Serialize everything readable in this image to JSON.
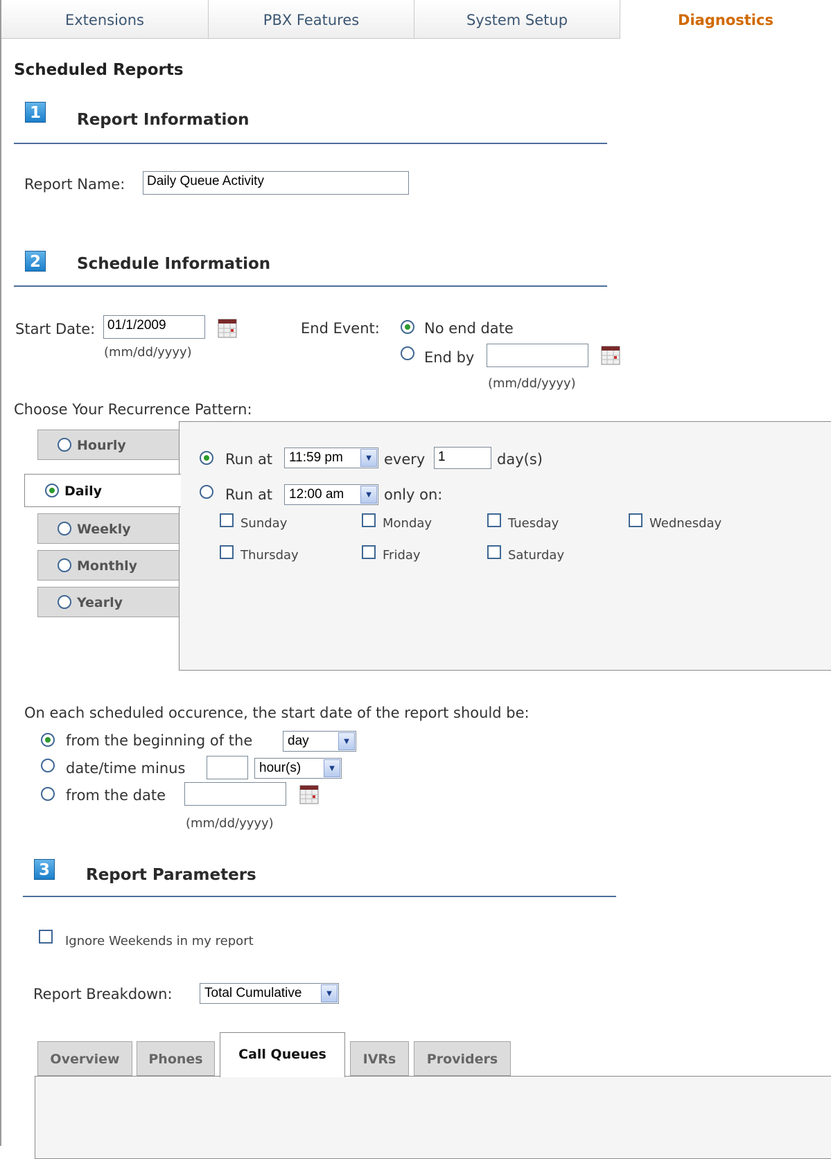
{
  "nav": {
    "tabs": [
      "Extensions",
      "PBX Features",
      "System Setup",
      "Diagnostics"
    ],
    "active": "Diagnostics"
  },
  "page_title": "Scheduled Reports",
  "section1": {
    "number": "1",
    "title": "Report Information",
    "report_name_label": "Report Name:",
    "report_name_value": "Daily Queue Activity"
  },
  "section2": {
    "number": "2",
    "title": "Schedule Information",
    "start_date_label": "Start Date:",
    "start_date_value": "01/1/2009",
    "date_hint": "(mm/dd/yyyy)",
    "end_event_label": "End Event:",
    "end_options": [
      "No end date",
      "End by"
    ],
    "end_by_value": "",
    "recurrence_label": "Choose Your Recurrence Pattern:",
    "recurrence_tabs": [
      "Hourly",
      "Daily",
      "Weekly",
      "Monthly",
      "Yearly"
    ],
    "recurrence_selected": "Daily",
    "daily": {
      "run_at_label": "Run at",
      "run_at_1": "11:59 pm",
      "every_label": "every",
      "every_value": "1",
      "days_label": "day(s)",
      "run_at_2": "12:00 am",
      "only_on_label": "only on:",
      "days": [
        "Sunday",
        "Monday",
        "Tuesday",
        "Wednesday",
        "Thursday",
        "Friday",
        "Saturday"
      ]
    },
    "occurrence_label": "On each scheduled occurence, the start date of the report should be:",
    "occ_opt1": "from the beginning of the",
    "occ_opt1_select": "day",
    "occ_opt2": "date/time minus",
    "occ_opt2_value": "",
    "occ_opt2_select": "hour(s)",
    "occ_opt3": "from the date",
    "occ_opt3_value": ""
  },
  "section3": {
    "number": "3",
    "title": "Report Parameters",
    "ignore_weekends": "Ignore Weekends in my report",
    "breakdown_label": "Report Breakdown:",
    "breakdown_value": "Total Cumulative",
    "tabs": [
      "Overview",
      "Phones",
      "Call Queues",
      "IVRs",
      "Providers"
    ],
    "active_tab": "Call Queues"
  },
  "colors": {
    "accent": "#d06a00",
    "link_blue": "#3c5672",
    "rule": "#4d6f9a",
    "radio_on": "#2d9a2d"
  }
}
